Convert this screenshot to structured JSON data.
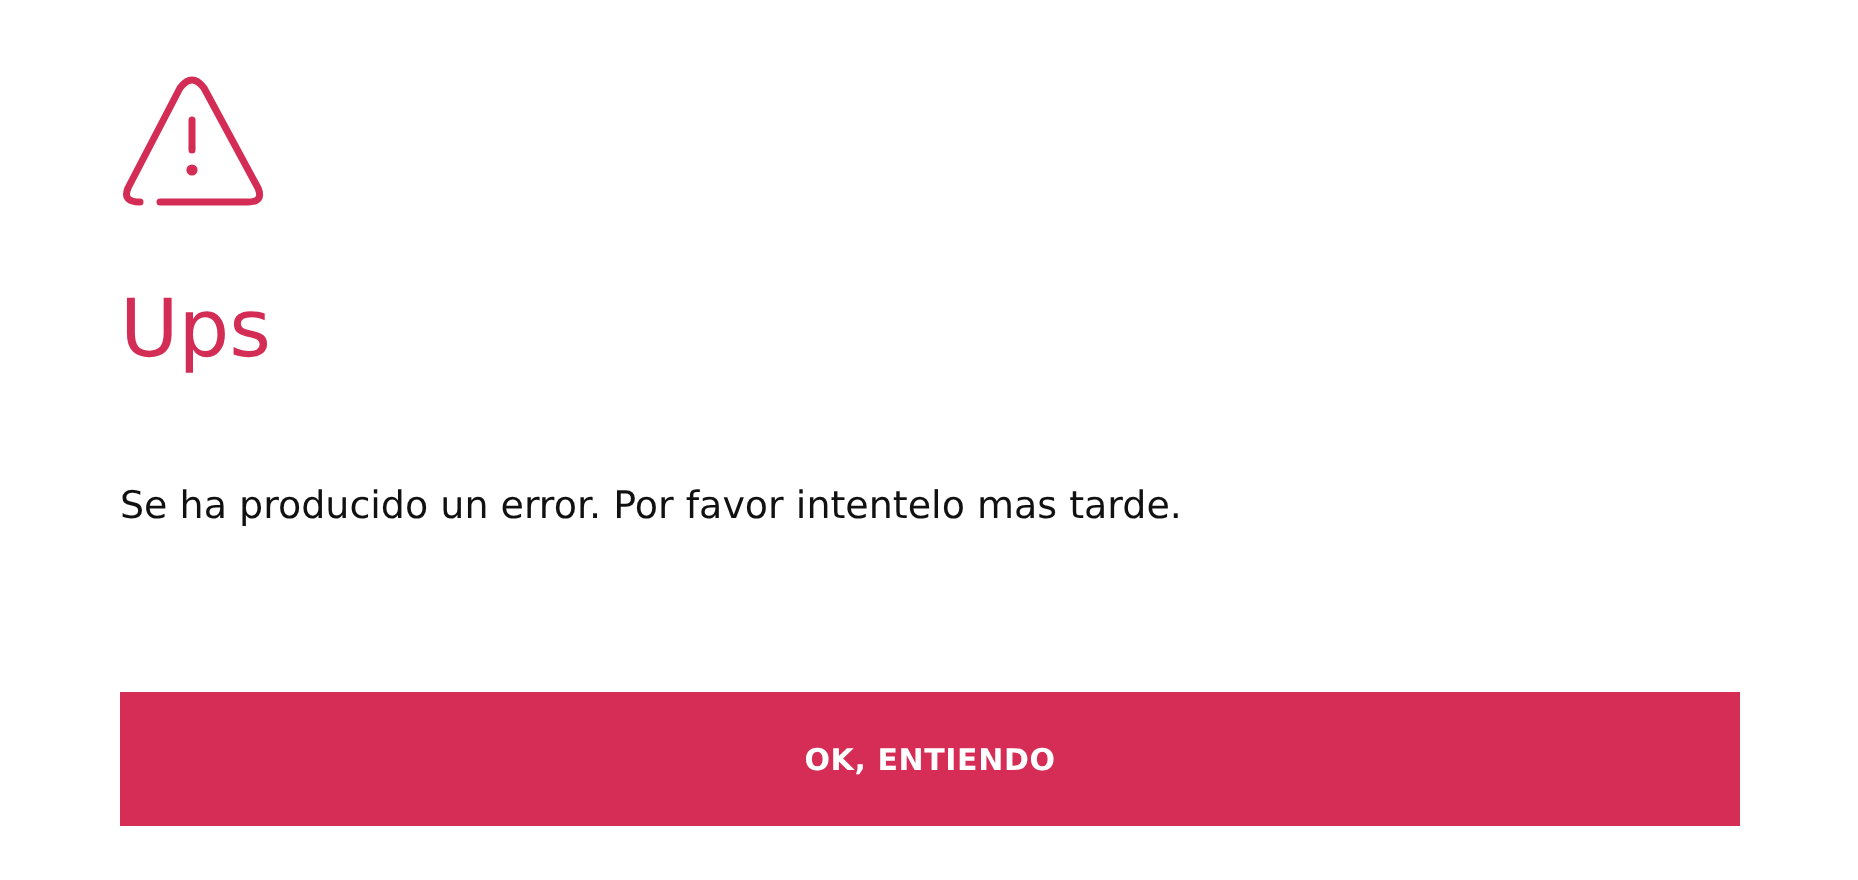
{
  "dialog": {
    "title": "Ups",
    "message": "Se ha producido un error. Por favor intentelo mas tarde.",
    "button": "OK, ENTIENDO"
  }
}
